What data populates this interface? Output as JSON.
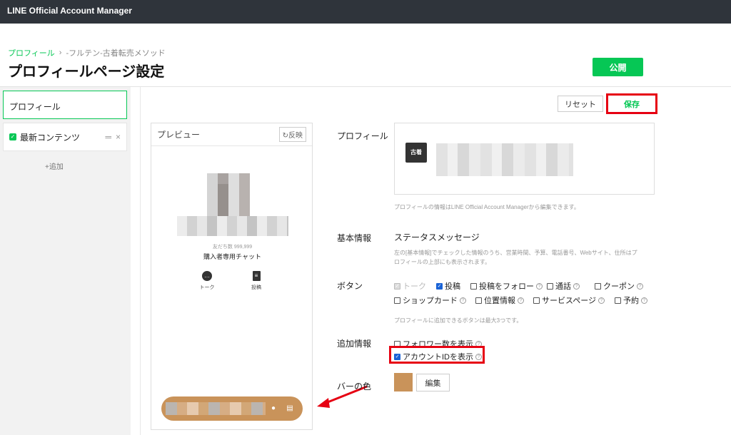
{
  "app": {
    "title": "LINE Official Account Manager"
  },
  "breadcrumb": {
    "parent": "プロフィール",
    "current": "-フルテン-古着転売メソッド"
  },
  "page": {
    "title": "プロフィールページ設定",
    "publish": "公開"
  },
  "sidebar": {
    "profile": "プロフィール",
    "content": "最新コンテンツ",
    "add": "+追加"
  },
  "toolbar": {
    "reset": "リセット",
    "save": "保存"
  },
  "preview": {
    "title": "プレビュー",
    "reflect": "反映",
    "friends": "友だち数 999,999",
    "chat_name": "購入者専用チャット",
    "talk": "トーク",
    "post": "投稿"
  },
  "profile": {
    "label": "プロフィール",
    "note": "プロフィールの情報はLINE Official Account Managerから編集できます。"
  },
  "basic": {
    "label": "基本情報",
    "status": "ステータスメッセージ",
    "note_line1": "左の[基本情報]でチェックした情報のうち、営業時間、予算、電話番号、Webサイト、住所はプ",
    "note_line2": "ロフィールの上部にも表示されます。"
  },
  "buttons": {
    "label": "ボタン",
    "talk": "トーク",
    "post": "投稿",
    "follow": "投稿をフォロー",
    "call": "通話",
    "coupon": "クーポン",
    "shopcard": "ショップカード",
    "location": "位置情報",
    "service": "サービスページ",
    "reserve": "予約",
    "note": "プロフィールに追加できるボタンは最大3つです。"
  },
  "extra": {
    "label": "追加情報",
    "followers": "フォロワー数を表示",
    "account_id": "アカウントIDを表示"
  },
  "barcolor": {
    "label": "バーの色",
    "edit": "編集",
    "value": "#c9935a"
  },
  "colors": {
    "accent": "#06c755",
    "highlight": "#e60012",
    "checkbox": "#1a63d6"
  }
}
